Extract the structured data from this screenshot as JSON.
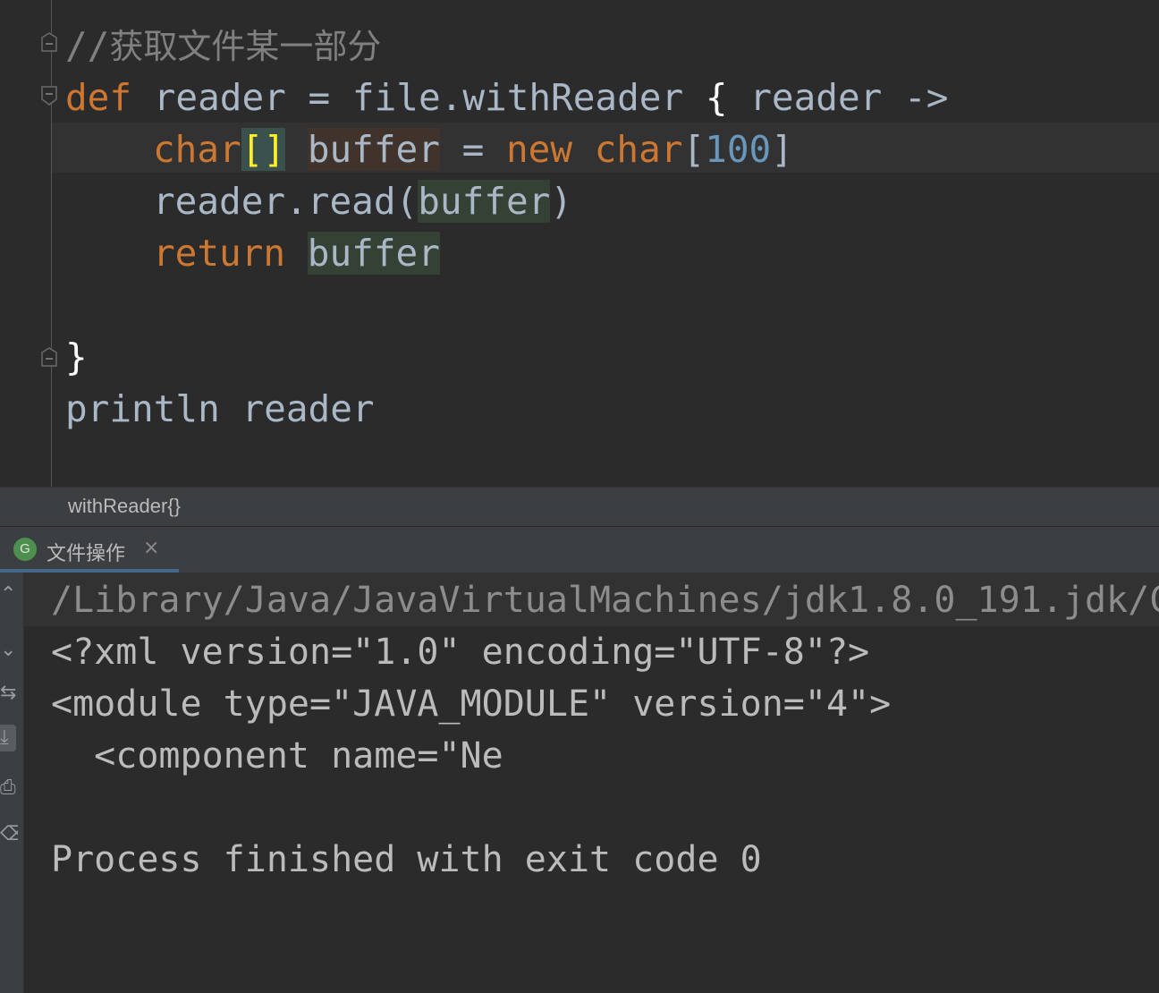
{
  "editor": {
    "comment_slashes": "//",
    "comment_text": "获取文件某一部分",
    "line2": {
      "kw_def": "def",
      "text1": " reader = file.withReader ",
      "brace_open": "{",
      "text2": " reader ->"
    },
    "line3": {
      "kw_char": "char",
      "brackets": "[]",
      "space": " ",
      "buffer_decl": "buffer",
      "eq": " = ",
      "kw_new": "new",
      "space2": " ",
      "kw_char2": "char",
      "bracket_open": "[",
      "size": "100",
      "bracket_close": "]"
    },
    "line4": {
      "call": "reader.read(",
      "buffer_ref": "buffer",
      "paren_close": ")"
    },
    "line5": {
      "kw_return": "return",
      "space": " ",
      "buffer_ref": "buffer"
    },
    "closing_brace": "}",
    "line8": "println reader"
  },
  "breadcrumb": {
    "text": "withReader{}"
  },
  "run_tab": {
    "badge": "G",
    "title": "文件操作",
    "close": "×"
  },
  "console": {
    "cmd_line": "/Library/Java/JavaVirtualMachines/jdk1.8.0_191.jdk/C",
    "line_xml": "<?xml version=\"1.0\" encoding=\"UTF-8\"?>",
    "line_module": "<module type=\"JAVA_MODULE\" version=\"4\">",
    "line_component": "  <component name=\"Ne",
    "line_exit": "Process finished with exit code 0"
  },
  "toolbar_icons": [
    {
      "name": "scroll-up-icon",
      "glyph": "⌃"
    },
    {
      "name": "scroll-down-icon",
      "glyph": "⌄"
    },
    {
      "name": "soft-wrap-icon",
      "glyph": "⇆"
    },
    {
      "name": "scroll-to-end-icon",
      "glyph": "⤓"
    },
    {
      "name": "print-icon",
      "glyph": "⎙"
    },
    {
      "name": "clear-all-icon",
      "glyph": "⌫"
    }
  ],
  "colors": {
    "editor_bg": "#2b2b2b",
    "keyword": "#cc7832",
    "number": "#6897bb",
    "comment": "#808080",
    "default_text": "#a9b7c6",
    "panel_bg": "#3c3f41",
    "groovy_badge": "#4e8f4f"
  }
}
